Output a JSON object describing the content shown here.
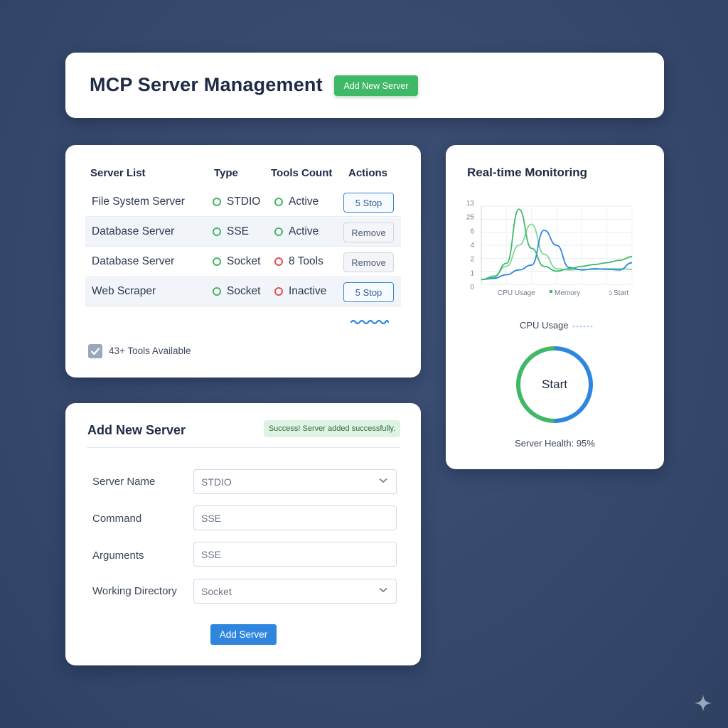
{
  "header": {
    "title": "MCP Server Management",
    "add_button": "Add New Server"
  },
  "server_list": {
    "columns": [
      "Server List",
      "Type",
      "Tools Count",
      "Actions"
    ],
    "rows": [
      {
        "name": "File System Server",
        "type": "STDIO",
        "status": "Active",
        "status_color": "green",
        "action": "5 Stop",
        "action_style": "blue"
      },
      {
        "name": "Database Server",
        "type": "SSE",
        "status": "Active",
        "status_color": "green",
        "action": "Remove",
        "action_style": "plain"
      },
      {
        "name": "Database Server",
        "type": "Socket",
        "status": "8 Tools",
        "status_color": "red",
        "action": "Remove",
        "action_style": "plain"
      },
      {
        "name": "Web Scraper",
        "type": "Socket",
        "status": "Inactive",
        "status_color": "red",
        "action": "5 Stop",
        "action_style": "blue"
      }
    ],
    "tools_available": "43+ Tools Available",
    "tools_checked": true
  },
  "add_server": {
    "title": "Add New Server",
    "toast": "Success! Server added successfully.",
    "fields": [
      {
        "label": "Server Name",
        "value": "STDIO",
        "kind": "select"
      },
      {
        "label": "Command",
        "value": "SSE",
        "kind": "input"
      },
      {
        "label": "Arguments",
        "value": "SSE",
        "kind": "input"
      },
      {
        "label": "Working Directory",
        "value": "Socket",
        "kind": "select"
      }
    ],
    "submit": "Add Server"
  },
  "monitoring": {
    "title": "Real-time Monitoring",
    "gauge_label": "CPU Usage",
    "gauge_center": "Start",
    "health": "Server Health: 95%",
    "health_value": 95
  },
  "colors": {
    "green": "#3fb867",
    "blue": "#2f86df",
    "red": "#e34f55",
    "background": "#3a4c6e"
  },
  "chart_data": {
    "type": "line",
    "yticks": [
      "13",
      "25",
      "6",
      "4",
      "2",
      "1",
      "0"
    ],
    "legend": [
      "CPU Usage",
      "Memory",
      "Start"
    ],
    "series": [
      {
        "name": "CPU Usage",
        "color": "#3fb867",
        "x": [
          0,
          1,
          2,
          3,
          4,
          5,
          6,
          7,
          8,
          9,
          10,
          11,
          12
        ],
        "values": [
          0.8,
          1.2,
          3.5,
          12.5,
          6,
          3,
          2.2,
          2.6,
          3,
          3.3,
          3.6,
          4,
          4.6
        ]
      },
      {
        "name": "Memory",
        "color": "#2f86df",
        "x": [
          0,
          1,
          2,
          3,
          4,
          5,
          6,
          7,
          8,
          9,
          10,
          11,
          12
        ],
        "values": [
          0.8,
          1,
          1.6,
          2.4,
          3.2,
          9,
          6.5,
          2.8,
          2.4,
          2.6,
          2.5,
          2.4,
          3.6
        ]
      },
      {
        "name": "Start",
        "color": "#7ed89a",
        "x": [
          0,
          1,
          2,
          3,
          4,
          5,
          6,
          7,
          8,
          9,
          10,
          11,
          12
        ],
        "values": [
          0.8,
          1.4,
          3,
          6.5,
          10,
          5,
          2.6,
          2.4,
          2.5,
          2.5,
          2.6,
          2.6,
          2.5
        ]
      }
    ],
    "grid": true,
    "legend_position": "bottom"
  }
}
